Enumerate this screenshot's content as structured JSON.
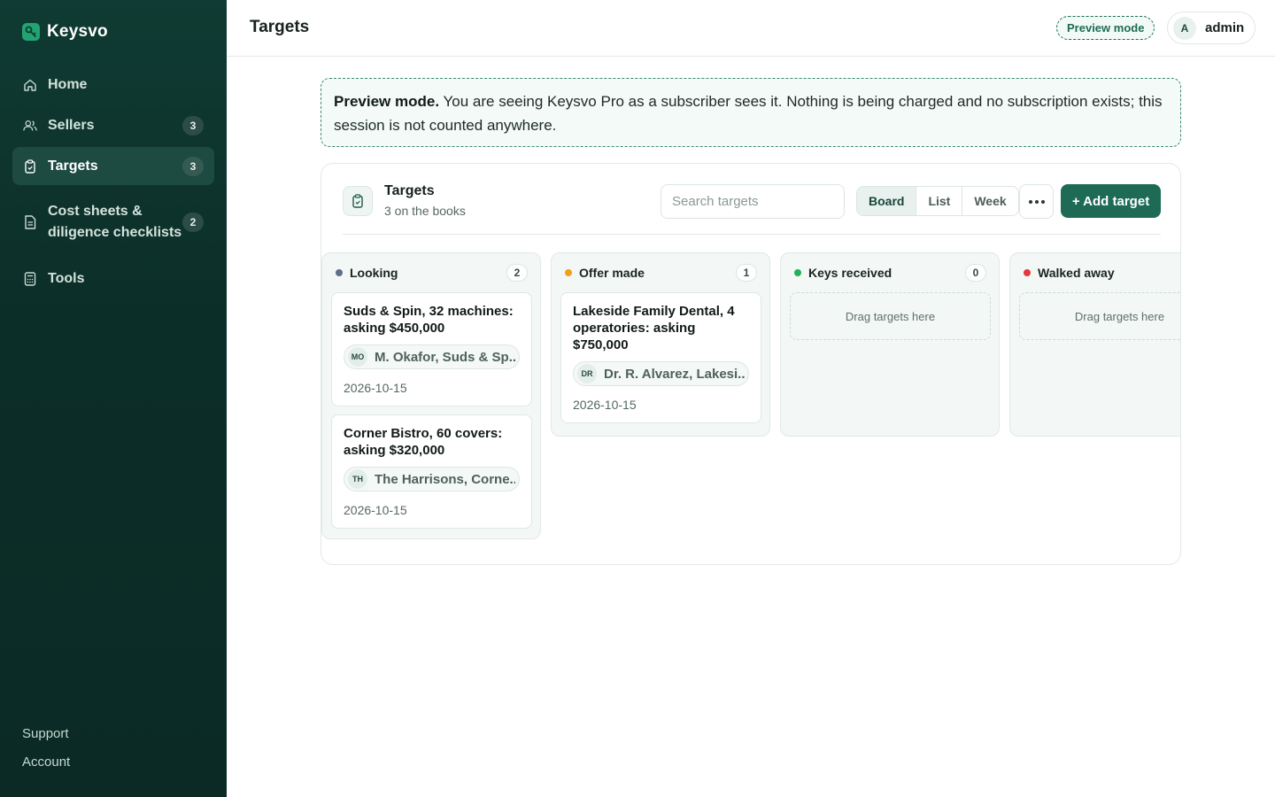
{
  "app": {
    "name": "Keysvo"
  },
  "sidebar": {
    "items": [
      {
        "label": "Home",
        "icon": "home-icon"
      },
      {
        "label": "Sellers",
        "icon": "users-icon",
        "badge": "3"
      },
      {
        "label": "Targets",
        "icon": "clipboard-icon",
        "badge": "3",
        "active": true
      },
      {
        "label": "Cost sheets & diligence checklists",
        "icon": "document-icon",
        "badge": "2"
      },
      {
        "label": "Tools",
        "icon": "calculator-icon"
      }
    ],
    "footer": {
      "support": "Support",
      "account": "Account"
    }
  },
  "header": {
    "title": "Targets",
    "preview_pill": "Preview mode",
    "user": {
      "initial": "A",
      "name": "admin"
    }
  },
  "banner": {
    "strong": "Preview mode.",
    "text": "You are seeing Keysvo Pro as a subscriber sees it. Nothing is being charged and no subscription exists; this session is not counted anywhere."
  },
  "panel": {
    "title": "Targets",
    "subtitle": "3 on the books",
    "search_placeholder": "Search targets",
    "views": [
      "Board",
      "List",
      "Week"
    ],
    "active_view": "Board",
    "add_label": "+ Add target"
  },
  "board": {
    "columns": [
      {
        "title": "Looking",
        "count": "2",
        "color": "#5f6f8a",
        "cards": [
          {
            "title": "Suds & Spin, 32 machines: asking $450,000",
            "initials": "MO",
            "contact": "M. Okafor, Suds & Sp...",
            "date": "2026-10-15"
          },
          {
            "title": "Corner Bistro, 60 covers: asking $320,000",
            "initials": "TH",
            "contact": "The Harrisons, Corne...",
            "date": "2026-10-15"
          }
        ]
      },
      {
        "title": "Offer made",
        "count": "1",
        "color": "#f0a01a",
        "cards": [
          {
            "title": "Lakeside Family Dental, 4 operatories: asking $750,000",
            "initials": "DR",
            "contact": "Dr. R. Alvarez, Lakesi...",
            "date": "2026-10-15"
          }
        ]
      },
      {
        "title": "Keys received",
        "count": "0",
        "color": "#22b25a",
        "empty": "Drag targets here"
      },
      {
        "title": "Walked away",
        "color": "#e23a3a",
        "empty": "Drag targets here"
      }
    ]
  }
}
